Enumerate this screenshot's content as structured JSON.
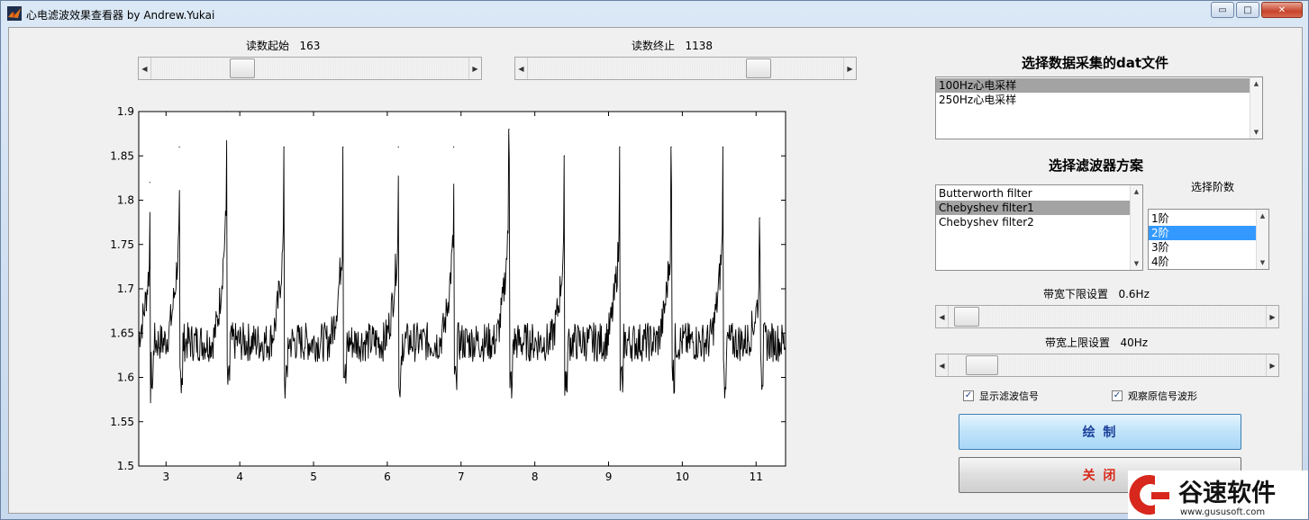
{
  "window": {
    "title": "心电滤波效果查看器 by Andrew.Yukai",
    "minimize_glyph": "▭",
    "maximize_glyph": "□",
    "close_glyph": "✕"
  },
  "start_slider": {
    "label": "读数起始",
    "value": "163",
    "position": 0.27
  },
  "end_slider": {
    "label": "读数终止",
    "value": "1138",
    "position": 0.75
  },
  "file_panel": {
    "heading": "选择数据采集的dat文件",
    "items": [
      "100Hz心电采样",
      "250Hz心电采样"
    ],
    "selected_index": 0
  },
  "filter_panel": {
    "heading": "选择滤波器方案",
    "items": [
      "Butterworth filter",
      "Chebyshev filter1",
      "Chebyshev filter2"
    ],
    "selected_index": 1
  },
  "order_panel": {
    "label": "选择阶数",
    "items": [
      "1阶",
      "2阶",
      "3阶",
      "4阶"
    ],
    "selected_index": 1
  },
  "low_cut": {
    "label": "带宽下限设置",
    "value": "0.6Hz",
    "position": 0.02
  },
  "high_cut": {
    "label": "带宽上限设置",
    "value": "40Hz",
    "position": 0.06
  },
  "options": {
    "show_filtered": {
      "label": "显示滤波信号",
      "checked": true
    },
    "show_original": {
      "label": "观察原信号波形",
      "checked": true
    }
  },
  "buttons": {
    "plot": "绘 制",
    "close": "关 闭"
  },
  "watermark": {
    "brand": "谷速软件",
    "url": "www.gususoft.com"
  },
  "chart_data": {
    "type": "line",
    "title": "",
    "xlabel": "",
    "ylabel": "",
    "xlim": [
      2.63,
      11.4
    ],
    "ylim": [
      1.5,
      1.9
    ],
    "x_ticks": [
      3,
      4,
      5,
      6,
      7,
      8,
      9,
      10,
      11
    ],
    "y_ticks": [
      1.5,
      1.55,
      1.6,
      1.65,
      1.7,
      1.75,
      1.8,
      1.85,
      1.9
    ],
    "grid": false,
    "baseline": 1.64,
    "beats": [
      {
        "r_peak_x": 2.78,
        "r_peak_y": 1.82
      },
      {
        "r_peak_x": 3.18,
        "r_peak_y": 1.86
      },
      {
        "r_peak_x": 3.82,
        "r_peak_y": 1.9
      },
      {
        "r_peak_x": 4.6,
        "r_peak_y": 1.86
      },
      {
        "r_peak_x": 5.4,
        "r_peak_y": 1.86
      },
      {
        "r_peak_x": 6.15,
        "r_peak_y": 1.86
      },
      {
        "r_peak_x": 6.9,
        "r_peak_y": 1.86
      },
      {
        "r_peak_x": 7.65,
        "r_peak_y": 1.88
      },
      {
        "r_peak_x": 8.4,
        "r_peak_y": 1.85
      },
      {
        "r_peak_x": 9.15,
        "r_peak_y": 1.86
      },
      {
        "r_peak_x": 9.85,
        "r_peak_y": 1.86
      },
      {
        "r_peak_x": 10.55,
        "r_peak_y": 1.86
      },
      {
        "r_peak_x": 11.05,
        "r_peak_y": 1.78
      }
    ]
  }
}
